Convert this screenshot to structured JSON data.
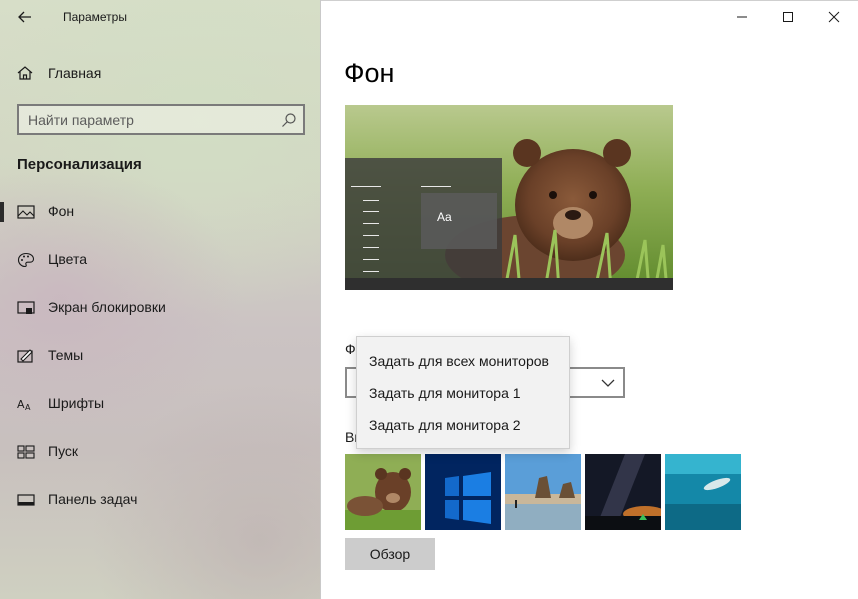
{
  "window": {
    "title": "Параметры",
    "controls": [
      "minimize-icon",
      "maximize-icon",
      "close-icon"
    ]
  },
  "sidebar": {
    "home_label": "Главная",
    "search_placeholder": "Найти параметр",
    "section_title": "Персонализация",
    "items": [
      {
        "label": "Фон",
        "icon": "picture-icon",
        "selected": true
      },
      {
        "label": "Цвета",
        "icon": "palette-icon",
        "selected": false
      },
      {
        "label": "Экран блокировки",
        "icon": "lock-screen-icon",
        "selected": false
      },
      {
        "label": "Темы",
        "icon": "themes-icon",
        "selected": false
      },
      {
        "label": "Шрифты",
        "icon": "fonts-icon",
        "selected": false
      },
      {
        "label": "Пуск",
        "icon": "start-icon",
        "selected": false
      },
      {
        "label": "Панель задач",
        "icon": "taskbar-icon",
        "selected": false
      }
    ]
  },
  "main": {
    "page_title": "Фон",
    "preview_sample_text": "Aa",
    "background_label_partial": "Ф",
    "choose_picture_label_partial": "Вы",
    "dropdown_options": [
      "Задать для всех мониторов",
      "Задать для монитора 1",
      "Задать для монитора 2"
    ],
    "thumbnails": [
      "bear-cub",
      "windows-10-blue",
      "beach-rocks",
      "night-sky",
      "underwater-swimmer"
    ],
    "browse_label": "Обзор"
  },
  "colors": {
    "accent_dark": "#2b2b2b",
    "button_gray": "#cccccc"
  }
}
